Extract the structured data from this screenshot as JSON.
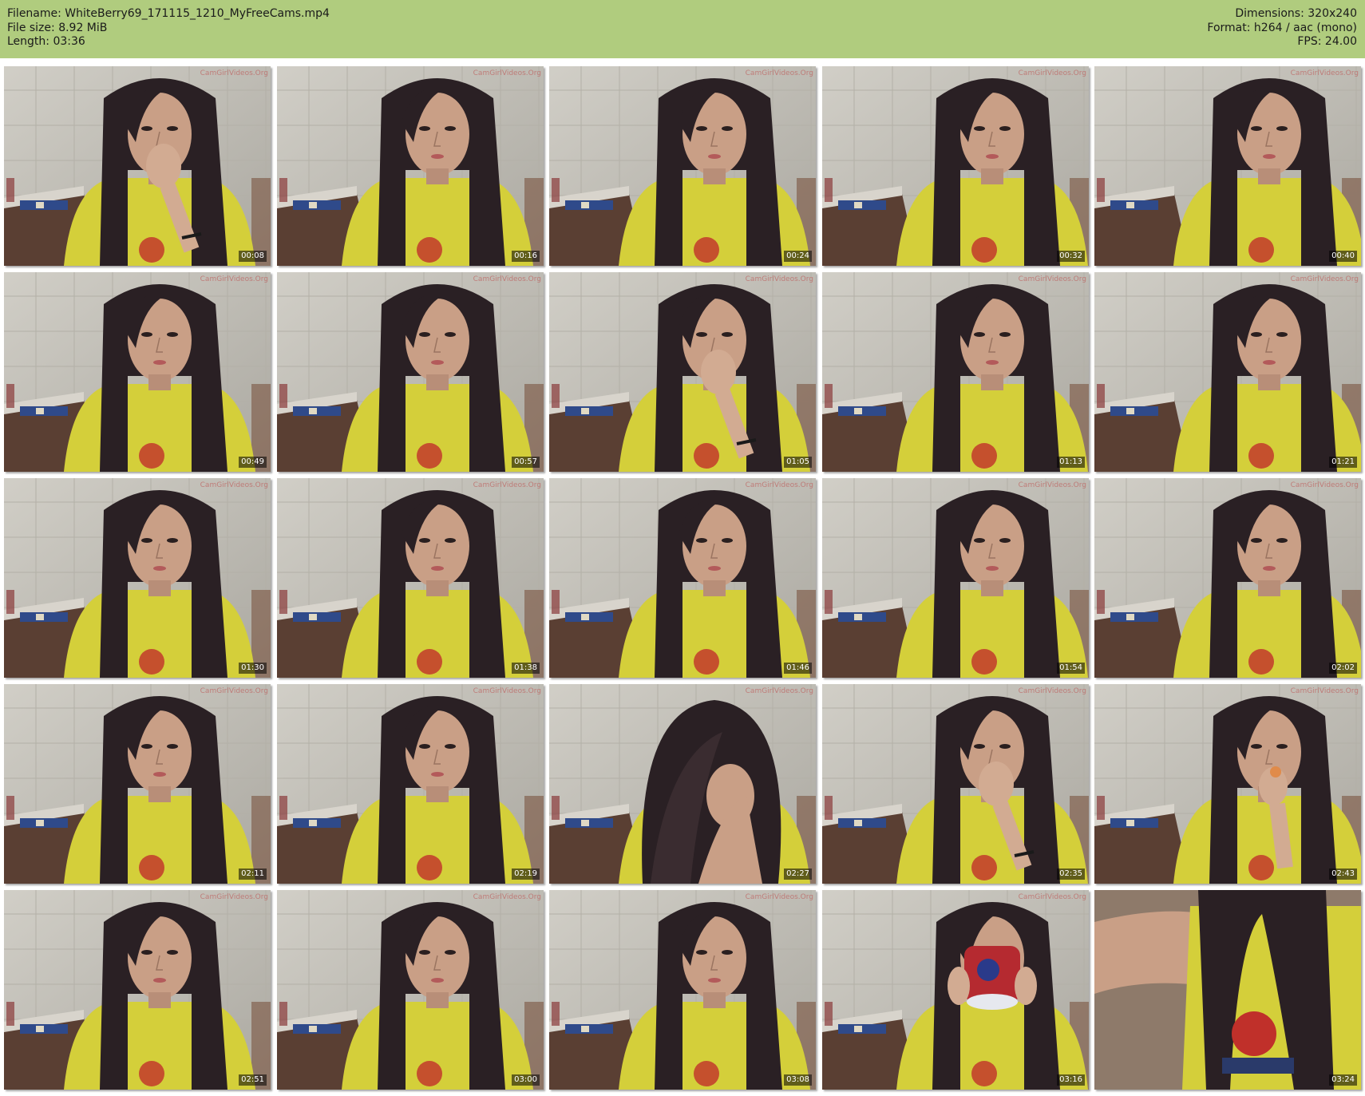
{
  "header": {
    "filename": "Filename: WhiteBerry69_171115_1210_MyFreeCams.mp4",
    "file_size": "File size: 8.92 MiB",
    "length": "Length: 03:36",
    "dimensions": "Dimensions: 320x240",
    "format": "Format: h264 / aac (mono)",
    "fps": "FPS: 24.00"
  },
  "watermark": "CamGirlVideos.Org",
  "colors": {
    "header_bg": "#b0cc7e",
    "wall": "#c9c6bd",
    "shirt": "#d4cf3a",
    "hair": "#2a2024",
    "skin": "#c99f86"
  },
  "thumbnails": [
    {
      "time": "00:08",
      "scene": "hand-mouth"
    },
    {
      "time": "00:16",
      "scene": "face"
    },
    {
      "time": "00:24",
      "scene": "face"
    },
    {
      "time": "00:32",
      "scene": "face"
    },
    {
      "time": "00:40",
      "scene": "face"
    },
    {
      "time": "00:49",
      "scene": "face"
    },
    {
      "time": "00:57",
      "scene": "face"
    },
    {
      "time": "01:05",
      "scene": "hand-mouth"
    },
    {
      "time": "01:13",
      "scene": "face"
    },
    {
      "time": "01:21",
      "scene": "face"
    },
    {
      "time": "01:30",
      "scene": "face"
    },
    {
      "time": "01:38",
      "scene": "face"
    },
    {
      "time": "01:46",
      "scene": "face"
    },
    {
      "time": "01:54",
      "scene": "face"
    },
    {
      "time": "02:02",
      "scene": "face"
    },
    {
      "time": "02:11",
      "scene": "face"
    },
    {
      "time": "02:19",
      "scene": "face"
    },
    {
      "time": "02:27",
      "scene": "covering-face"
    },
    {
      "time": "02:35",
      "scene": "hand-mouth"
    },
    {
      "time": "02:43",
      "scene": "eating"
    },
    {
      "time": "02:51",
      "scene": "face"
    },
    {
      "time": "03:00",
      "scene": "face"
    },
    {
      "time": "03:08",
      "scene": "face"
    },
    {
      "time": "03:16",
      "scene": "mug"
    },
    {
      "time": "03:24",
      "scene": "close-shirt"
    }
  ]
}
